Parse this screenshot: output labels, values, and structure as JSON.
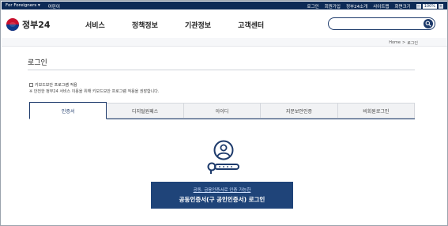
{
  "topbar": {
    "foreigners": "For Foreigners ▾",
    "kids": "어린이",
    "login": "로그인",
    "signup": "회원가입",
    "intro": "정부24소개",
    "sitemap": "사이트맵",
    "screen_size": "화면크기",
    "zoom_minus": "−",
    "zoom_value": "100%",
    "zoom_plus": "+"
  },
  "header": {
    "logo_text": "정부24",
    "nav": [
      "서비스",
      "정책정보",
      "기관정보",
      "고객센터"
    ],
    "search_placeholder": ""
  },
  "breadcrumb": {
    "home": "Home",
    "sep": ">",
    "current": "로그인"
  },
  "main": {
    "title": "로그인",
    "keyboard_security_label": "키보드보안 프로그램 적용",
    "keyboard_security_note": "※ 안전한 정부24 서비스 이용을 위해 키보드보안 프로그램 적용을 권장합니다.",
    "tabs": [
      {
        "label": "인증서",
        "active": true
      },
      {
        "label": "디지털원패스",
        "active": false
      },
      {
        "label": "아이디",
        "active": false
      },
      {
        "label": "지문보안인증",
        "active": false
      },
      {
        "label": "비회원로그인",
        "active": false
      }
    ],
    "login_button_sub": "공동, 금융인증서로 인증 가능한",
    "login_button_main": "공동인증서(구 공인인증서) 로그인"
  },
  "colors": {
    "topbar_bg": "#0d2a55",
    "accent": "#1d3a6b",
    "button_bg": "#1f4479"
  },
  "icons": [
    "search-icon",
    "certificate-user-icon",
    "key-icon",
    "chevron-down-icon"
  ]
}
